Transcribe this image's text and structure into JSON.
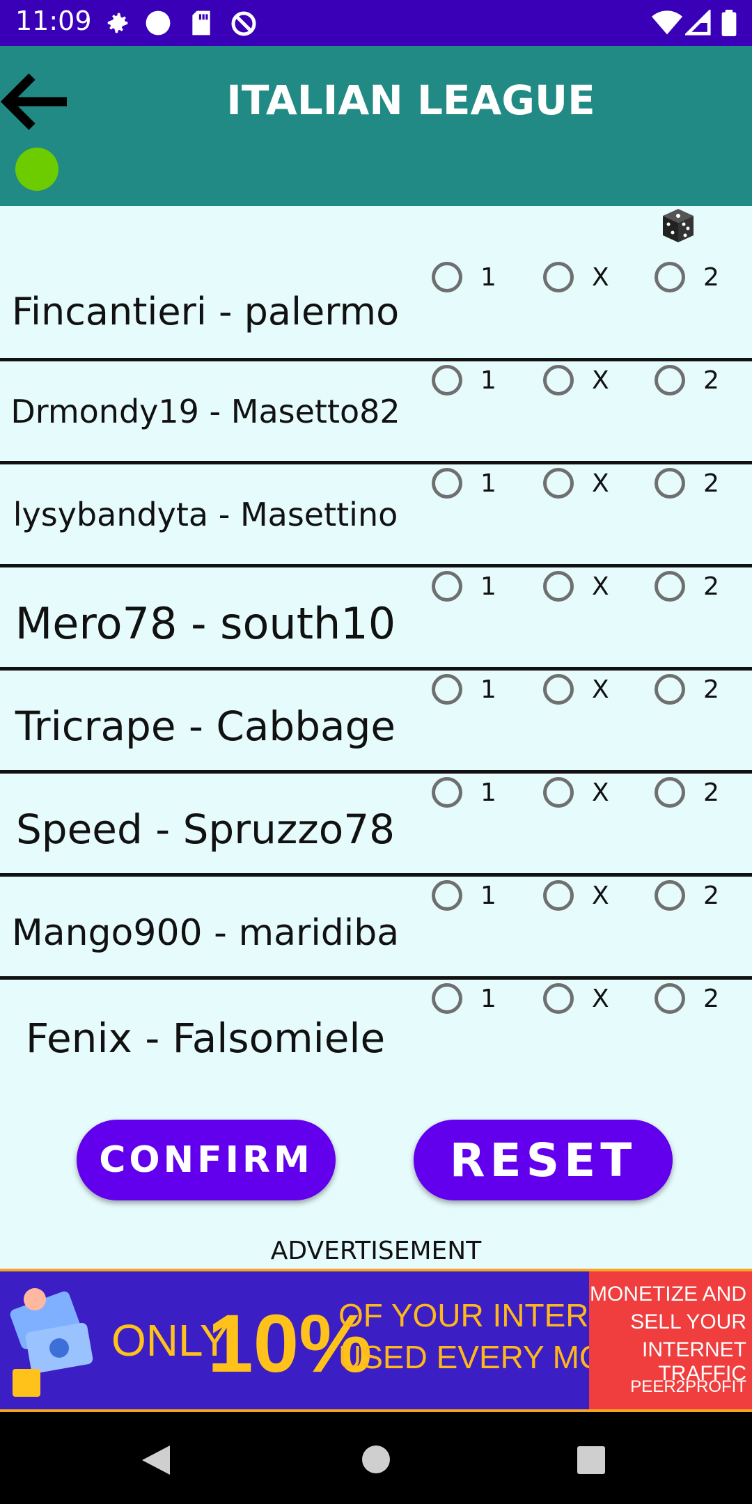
{
  "status_bar": {
    "time": "11:09"
  },
  "header": {
    "title": "ITALIAN LEAGUE"
  },
  "matches": [
    {
      "name": "Fincantieri - palermo",
      "opt1": "1",
      "optx": "X",
      "opt2": "2"
    },
    {
      "name": "Drmondy19 - Masetto82",
      "opt1": "1",
      "optx": "X",
      "opt2": "2"
    },
    {
      "name": "lysybandyta - Masettino",
      "opt1": "1",
      "optx": "X",
      "opt2": "2"
    },
    {
      "name": "Mero78 - south10",
      "opt1": "1",
      "optx": "X",
      "opt2": "2"
    },
    {
      "name": "Tricrape - Cabbage",
      "opt1": "1",
      "optx": "X",
      "opt2": "2"
    },
    {
      "name": "Speed - Spruzzo78",
      "opt1": "1",
      "optx": "X",
      "opt2": "2"
    },
    {
      "name": "Mango900 - maridiba",
      "opt1": "1",
      "optx": "X",
      "opt2": "2"
    },
    {
      "name": "Fenix - Falsomiele",
      "opt1": "1",
      "optx": "X",
      "opt2": "2"
    }
  ],
  "buttons": {
    "confirm": "CONFIRM",
    "reset": "RESET"
  },
  "ad": {
    "label": "ADVERTISEMENT",
    "banner_only": "ONLY",
    "banner_percent": "10%",
    "banner_line1": "OF YOUR INTERNET IS",
    "banner_line2": "USED EVERY MONTH",
    "banner_right1": "MONETIZE AND",
    "banner_right2": "SELL YOUR",
    "banner_right3": "INTERNET TRAFFIC",
    "banner_brand": "PEER2PROFIT"
  },
  "colors": {
    "status_bar": "#3a00b8",
    "app_bar": "#228a84",
    "button": "#6200ee",
    "background": "#e6fbfc",
    "online_dot": "#6ccc00"
  }
}
